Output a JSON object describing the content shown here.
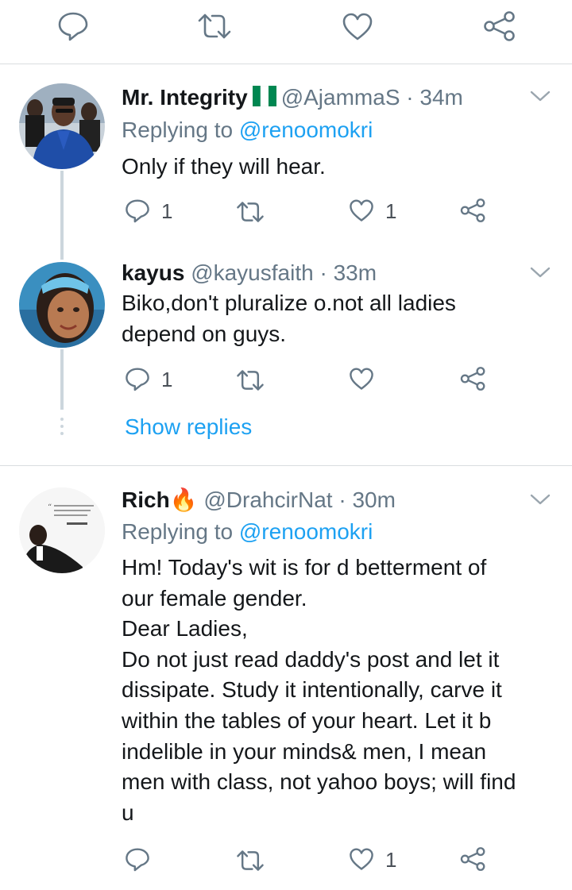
{
  "top_actions": {
    "reply_count": "",
    "retweet_count": "",
    "like_count": ""
  },
  "tweets": [
    {
      "name": "Mr. Integrity",
      "flag": "🇳🇬",
      "handle": "@AjammaS",
      "time": "· 34m",
      "replying_prefix": "Replying to",
      "replying_to": "@renoomokri",
      "lines": [
        "Only if they will hear."
      ],
      "reply_count": "1",
      "retweet_count": "",
      "like_count": "1"
    },
    {
      "name": "kayus",
      "handle": "@kayusfaith",
      "time": "· 33m",
      "lines": [
        "Biko,don't pluralize o.not all ladies",
        "depend on guys."
      ],
      "reply_count": "1",
      "retweet_count": "",
      "like_count": "",
      "show_replies": "Show replies"
    },
    {
      "name": "Rich",
      "emoji": "🔥",
      "handle": "@DrahcirNat",
      "time": "· 30m",
      "replying_prefix": "Replying to",
      "replying_to": "@renoomokri",
      "lines": [
        "Hm! Today's wit is for d betterment of",
        "our female gender.",
        "Dear Ladies,",
        "Do not just read daddy's post and let it",
        "dissipate. Study it intentionally, carve it",
        "within the tables of your heart. Let it b",
        "indelible in your minds& men, I mean",
        "men with class, not yahoo boys; will find",
        "u"
      ],
      "reply_count": "",
      "retweet_count": "",
      "like_count": "1"
    }
  ],
  "colors": {
    "link": "#1da1f2",
    "muted": "#657786",
    "text": "#14171a",
    "divider": "#d9dde0"
  }
}
